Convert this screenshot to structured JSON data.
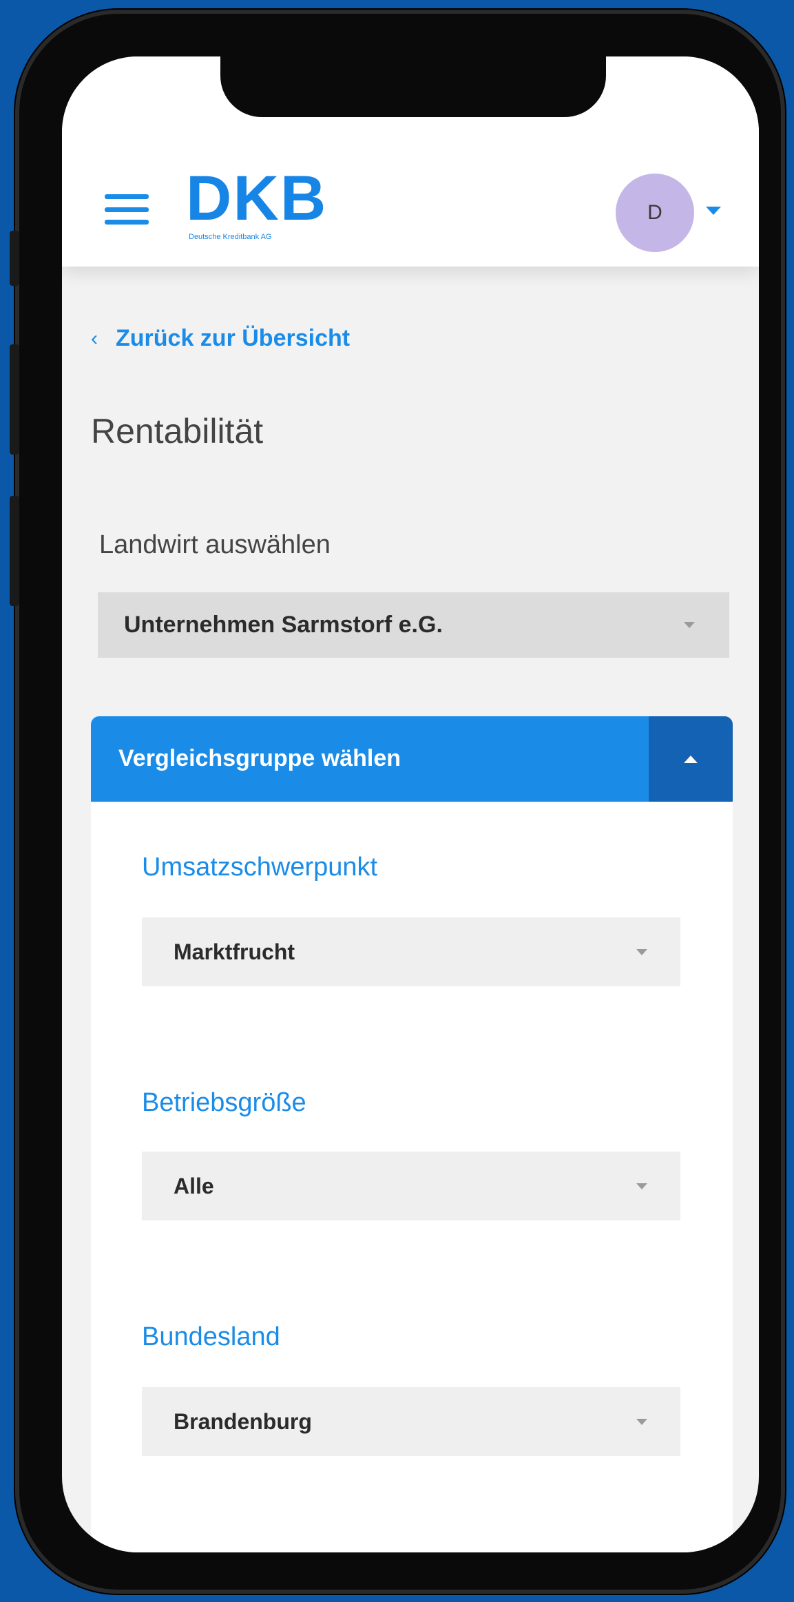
{
  "header": {
    "logo_text": "DKB",
    "logo_subtitle": "Deutsche Kreditbank AG",
    "avatar_initial": "D"
  },
  "nav": {
    "back_chevron": "‹",
    "back_label": "Zurück zur Übersicht"
  },
  "page": {
    "title": "Rentabilität"
  },
  "farmer_select": {
    "label": "Landwirt auswählen",
    "value": "Unternehmen Sarmstorf e.G."
  },
  "comparison_panel": {
    "header_label": "Vergleichsgruppe wählen",
    "expanded": true,
    "fields": [
      {
        "label": "Umsatzschwerpunkt",
        "value": "Marktfrucht"
      },
      {
        "label": "Betriebsgröße",
        "value": "Alle"
      },
      {
        "label": "Bundesland",
        "value": "Brandenburg"
      }
    ]
  },
  "colors": {
    "brand_blue": "#1a8ce8",
    "toggle_blue": "#1462b3",
    "avatar_purple": "#c4b6e6",
    "background_blue": "#0b58a8"
  }
}
